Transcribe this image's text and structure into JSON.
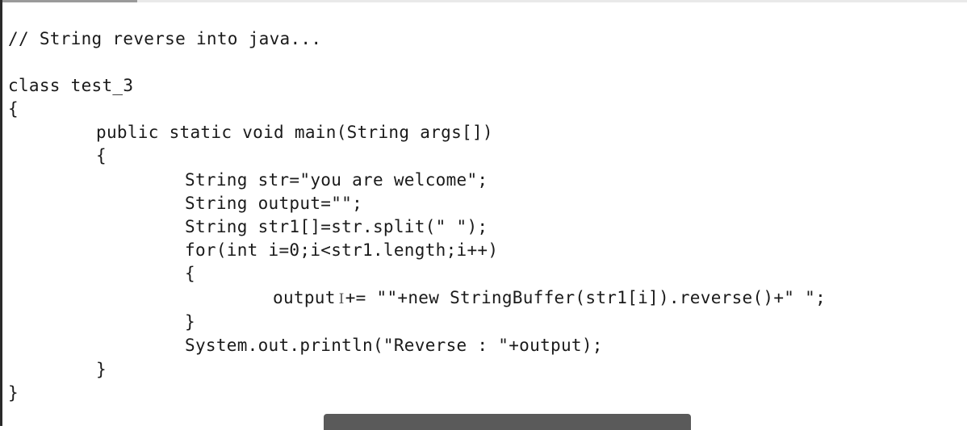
{
  "editor": {
    "comment": "// String reverse into java...",
    "class_decl": "class test_3",
    "class_open": "{",
    "method_sig": "public static void main(String args[])",
    "method_open": "{",
    "line_str": "String str=\"you are welcome\";",
    "line_output": "String output=\"\";",
    "line_split": "String str1[]=str.split(\" \");",
    "line_for": "for(int i=0;i<str1.length;i++)",
    "for_open": "{",
    "line_assign_start": "output",
    "text_cursor_glyph": "I",
    "line_assign_end": "+= \"\"+new StringBuffer(str1[i]).reverse()+\" \";",
    "for_close": "}",
    "line_print": "System.out.println(\"Reverse : \"+output);",
    "method_close": "}",
    "class_close": "}"
  },
  "colors": {
    "text": "#1a1a1a",
    "background": "#ffffff",
    "bottom_bar": "#5a5a5a"
  }
}
